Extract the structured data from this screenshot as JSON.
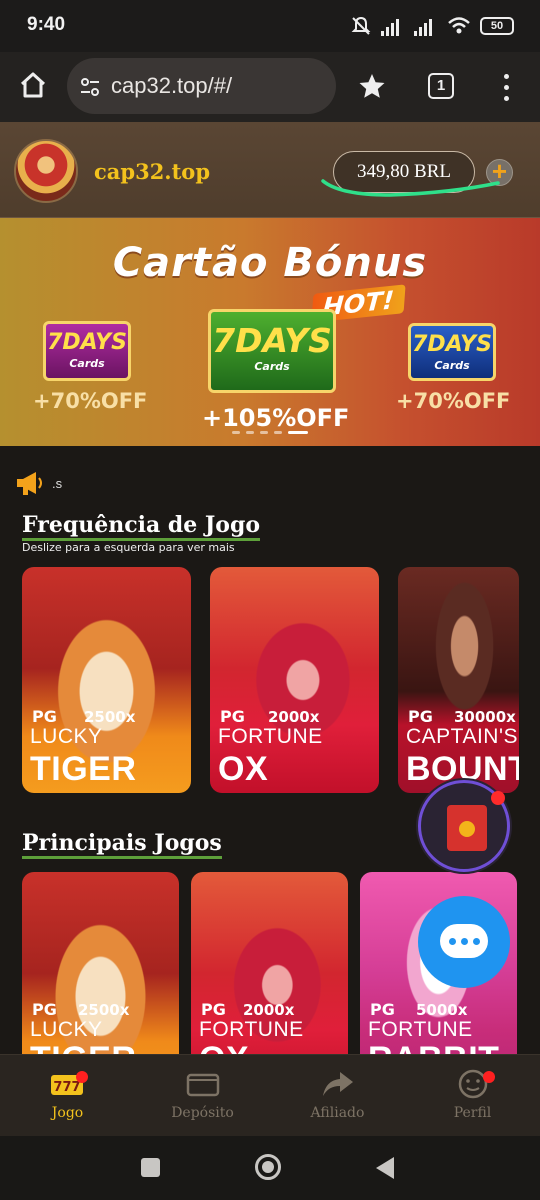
{
  "status": {
    "time": "9:40",
    "battery": "50"
  },
  "browser": {
    "url": "cap32.top/#/",
    "tab_count": "1",
    "icons": [
      "home-icon",
      "tune-icon",
      "star-icon",
      "tabs-icon",
      "more-vert-icon"
    ]
  },
  "header": {
    "site_name": "cap32.top",
    "balance": "349,80 BRL",
    "plus": "+"
  },
  "banner": {
    "title": "Cartão Bónus",
    "hot": "HOT!",
    "cards": [
      {
        "days": "7DAYS",
        "sub": "Cards",
        "off": "+70%OFF",
        "color": "#b02ca2"
      },
      {
        "days": "7DAYS",
        "sub": "Cards",
        "off": "+105%OFF",
        "color": "#4eaf2f"
      },
      {
        "days": "7DAYS",
        "sub": "Cards",
        "off": "+70%OFF",
        "color": "#2a5fc8"
      }
    ],
    "slide_count": 5,
    "active_slide": 5
  },
  "marquee": {
    "text": ".s"
  },
  "frequency": {
    "title": "Frequência de Jogo",
    "subtitle": "Deslize para a esquerda para ver mais",
    "games": [
      {
        "pg": "PG",
        "mult": "2500x",
        "name1": "LUCKY",
        "name2": "TIGER"
      },
      {
        "pg": "PG",
        "mult": "2000x",
        "name1": "FORTUNE",
        "name2": "OX"
      },
      {
        "pg": "PG",
        "mult": "30000x",
        "name1": "CAPTAIN'S",
        "name2": "BOUNTY"
      }
    ]
  },
  "main_games": {
    "title": "Principais Jogos",
    "games": [
      {
        "pg": "PG",
        "mult": "2500x",
        "name1": "LUCKY",
        "name2": "TIGER"
      },
      {
        "pg": "PG",
        "mult": "2000x",
        "name1": "FORTUNE",
        "name2": "OX"
      },
      {
        "pg": "PG",
        "mult": "5000x",
        "name1": "FORTUNE",
        "name2": "RABBIT"
      }
    ]
  },
  "bottom_nav": {
    "items": [
      {
        "label": "Jogo",
        "badge": "777"
      },
      {
        "label": "Depósito"
      },
      {
        "label": "Afiliado"
      },
      {
        "label": "Perfil"
      }
    ],
    "active_color": "#f3c21d"
  },
  "colors": {
    "gold": "#f3c21d",
    "header_bg": "#5a4634",
    "section_underline": "#5ea03a",
    "chat": "#1f94f0"
  }
}
